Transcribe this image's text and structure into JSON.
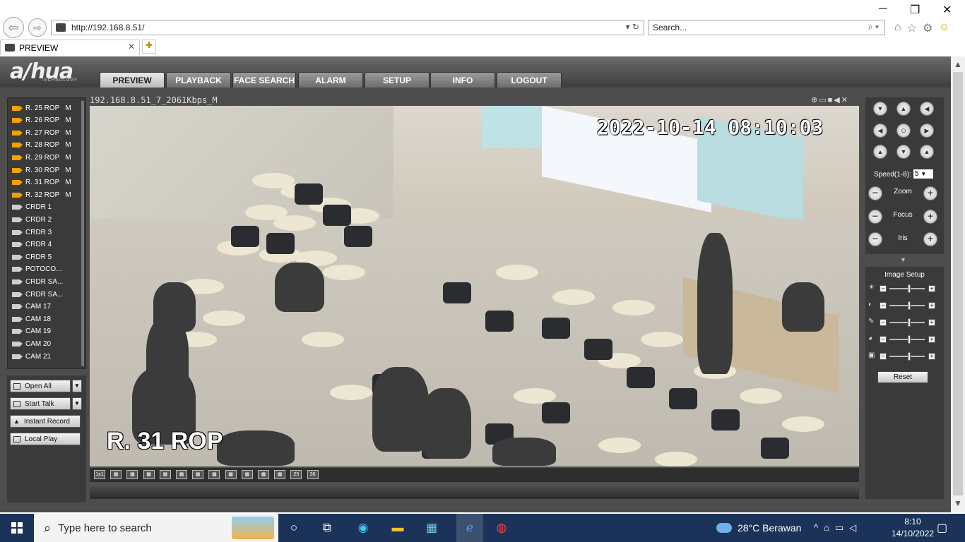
{
  "browser": {
    "url": "http://192.168.8.51/",
    "search_placeholder": "Search...",
    "tab_title": "PREVIEW",
    "window": {
      "minimize": "─",
      "restore": "❐",
      "close": "✕"
    }
  },
  "app": {
    "logo": "a/hua",
    "logo_sub": "TECHNOLOGY",
    "menu": [
      "PREVIEW",
      "PLAYBACK",
      "FACE SEARCH",
      "ALARM",
      "SETUP",
      "INFO",
      "LOGOUT"
    ],
    "active_menu": "PREVIEW",
    "cameras": [
      {
        "name": "R. 25 ROP",
        "mode": "M",
        "active": true
      },
      {
        "name": "R. 26 ROP",
        "mode": "M",
        "active": true
      },
      {
        "name": "R. 27 ROP",
        "mode": "M",
        "active": true
      },
      {
        "name": "R. 28 ROP",
        "mode": "M",
        "active": true
      },
      {
        "name": "R. 29 ROP",
        "mode": "M",
        "active": true
      },
      {
        "name": "R. 30 ROP",
        "mode": "M",
        "active": true
      },
      {
        "name": "R. 31 ROP",
        "mode": "M",
        "active": true
      },
      {
        "name": "R. 32 ROP",
        "mode": "M",
        "active": true
      },
      {
        "name": "CRDR 1",
        "mode": "",
        "active": false
      },
      {
        "name": "CRDR 2",
        "mode": "",
        "active": false
      },
      {
        "name": "CRDR 3",
        "mode": "",
        "active": false
      },
      {
        "name": "CRDR 4",
        "mode": "",
        "active": false
      },
      {
        "name": "CRDR 5",
        "mode": "",
        "active": false
      },
      {
        "name": "POTOCO...",
        "mode": "",
        "active": false
      },
      {
        "name": "CRDR SA...",
        "mode": "",
        "active": false
      },
      {
        "name": "CRDR SA...",
        "mode": "",
        "active": false
      },
      {
        "name": "CAM 17",
        "mode": "",
        "active": false
      },
      {
        "name": "CAM 18",
        "mode": "",
        "active": false
      },
      {
        "name": "CAM 19",
        "mode": "",
        "active": false
      },
      {
        "name": "CAM 20",
        "mode": "",
        "active": false
      },
      {
        "name": "CAM 21",
        "mode": "",
        "active": false
      }
    ],
    "controls": {
      "open_all": "Open All",
      "start_talk": "Start Talk",
      "instant_record": "Instant Record",
      "local_play": "Local Play"
    },
    "video": {
      "stream_title": "192.168.8.51_7_2061Kbps_M",
      "timestamp": "2022-10-14 08:10:03",
      "camera_label": "R. 31 ROP",
      "toolbar_icons": [
        "zoom-icon",
        "capture-icon",
        "record-icon",
        "audio-icon",
        "close-icon"
      ]
    },
    "layouts": [
      "1x1",
      "",
      "",
      "",
      "",
      "",
      "",
      "",
      "",
      "",
      "",
      "",
      "25",
      "36"
    ],
    "ptz": {
      "speed_label": "Speed(1-8):",
      "speed_value": "5",
      "zoom": "Zoom",
      "focus": "Focus",
      "iris": "Iris"
    },
    "image_setup": {
      "title": "Image Setup",
      "sliders": [
        {
          "icon": "brightness-icon",
          "level": 0.55
        },
        {
          "icon": "contrast-icon",
          "level": 0.55
        },
        {
          "icon": "saturation-icon",
          "level": 0.55
        },
        {
          "icon": "hue-icon",
          "level": 0.55
        },
        {
          "icon": "sharpness-icon",
          "level": 0.55
        }
      ],
      "reset": "Reset"
    }
  },
  "taskbar": {
    "search_placeholder": "Type here to search",
    "weather_temp": "28°C",
    "weather_text": "Berawan",
    "time": "8:10",
    "date": "14/10/2022"
  }
}
